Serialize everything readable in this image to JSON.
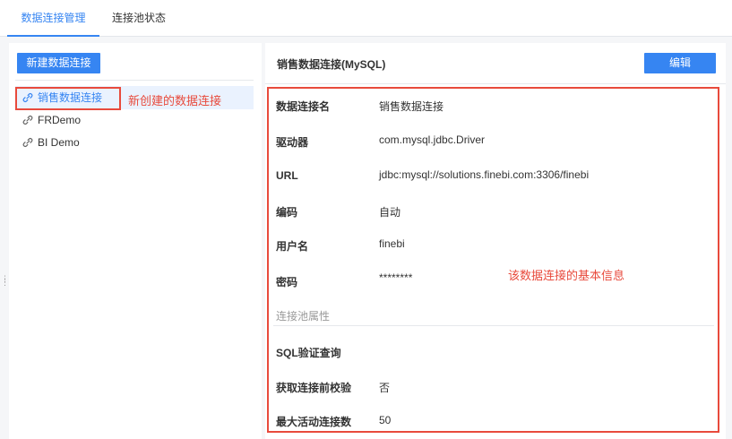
{
  "tabs": [
    {
      "label": "数据连接管理",
      "active": true
    },
    {
      "label": "连接池状态",
      "active": false
    }
  ],
  "left": {
    "new_button": "新建数据连接",
    "connections": [
      {
        "name": "销售数据连接",
        "selected": true
      },
      {
        "name": "FRDemo",
        "selected": false
      },
      {
        "name": "BI Demo",
        "selected": false
      }
    ],
    "annotation": "新创建的数据连接"
  },
  "detail": {
    "title": "销售数据连接(MySQL)",
    "edit_button": "编辑",
    "annotation": "该数据连接的基本信息",
    "fields": [
      {
        "label": "数据连接名",
        "value": "销售数据连接"
      },
      {
        "label": "驱动器",
        "value": "com.mysql.jdbc.Driver"
      },
      {
        "label": "URL",
        "value": "jdbc:mysql://solutions.finebi.com:3306/finebi"
      },
      {
        "label": "编码",
        "value": "自动"
      },
      {
        "label": "用户名",
        "value": "finebi"
      },
      {
        "label": "密码",
        "value": "********"
      }
    ],
    "pool_section": "连接池属性",
    "pool_fields": [
      {
        "label": "SQL验证查询",
        "value": ""
      },
      {
        "label": "获取连接前校验",
        "value": "否"
      },
      {
        "label": "最大活动连接数",
        "value": "50"
      }
    ]
  },
  "colors": {
    "accent": "#3685f2",
    "annotation": "#e84a3c"
  },
  "icons": {
    "connection": "link-icon"
  }
}
